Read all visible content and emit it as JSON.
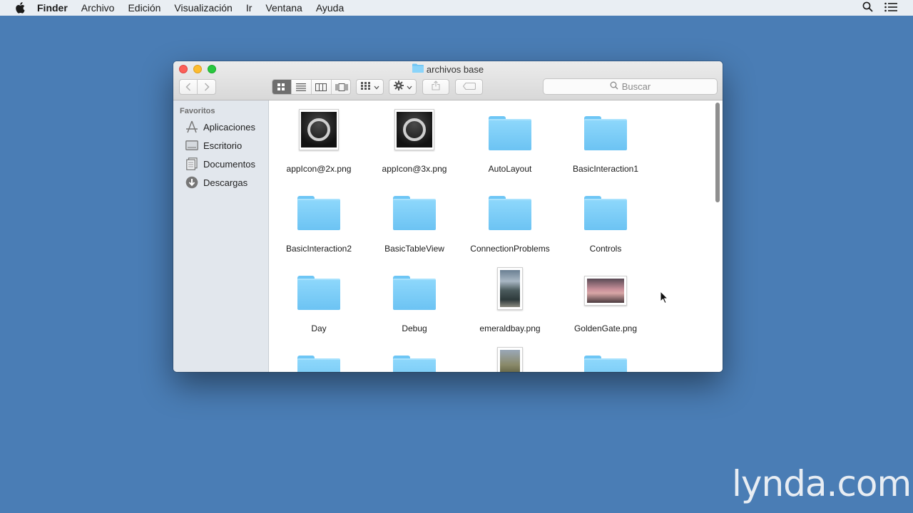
{
  "menubar": {
    "app_name": "Finder",
    "items": [
      "Archivo",
      "Edición",
      "Visualización",
      "Ir",
      "Ventana",
      "Ayuda"
    ]
  },
  "window": {
    "title": "archivos base",
    "search_placeholder": "Buscar",
    "view_mode_selected": "icon-view"
  },
  "sidebar": {
    "heading": "Favoritos",
    "items": [
      {
        "label": "Aplicaciones",
        "icon": "applications-icon"
      },
      {
        "label": "Escritorio",
        "icon": "desktop-icon"
      },
      {
        "label": "Documentos",
        "icon": "documents-icon"
      },
      {
        "label": "Descargas",
        "icon": "downloads-icon"
      }
    ]
  },
  "files": [
    {
      "label": "appIcon@2x.png",
      "kind": "app-icon-png"
    },
    {
      "label": "appIcon@3x.png",
      "kind": "app-icon-png"
    },
    {
      "label": "AutoLayout",
      "kind": "folder"
    },
    {
      "label": "BasicInteraction1",
      "kind": "folder"
    },
    {
      "label": "BasicInteraction2",
      "kind": "folder"
    },
    {
      "label": "BasicTableView",
      "kind": "folder"
    },
    {
      "label": "ConnectionProblems",
      "kind": "folder"
    },
    {
      "label": "Controls",
      "kind": "folder"
    },
    {
      "label": "Day",
      "kind": "folder"
    },
    {
      "label": "Debug",
      "kind": "folder"
    },
    {
      "label": "emeraldbay.png",
      "kind": "photo-tall"
    },
    {
      "label": "GoldenGate.png",
      "kind": "photo-wide"
    },
    {
      "label": "",
      "kind": "folder"
    },
    {
      "label": "",
      "kind": "folder"
    },
    {
      "label": "",
      "kind": "photo-tall"
    },
    {
      "label": "",
      "kind": "folder"
    }
  ],
  "watermark": "lynda.com",
  "colors": {
    "desktop": "#4a7db5",
    "folder": "#7ccdf7",
    "close": "#fc5f57",
    "minimize": "#fdbc2e",
    "maximize": "#28c840"
  }
}
